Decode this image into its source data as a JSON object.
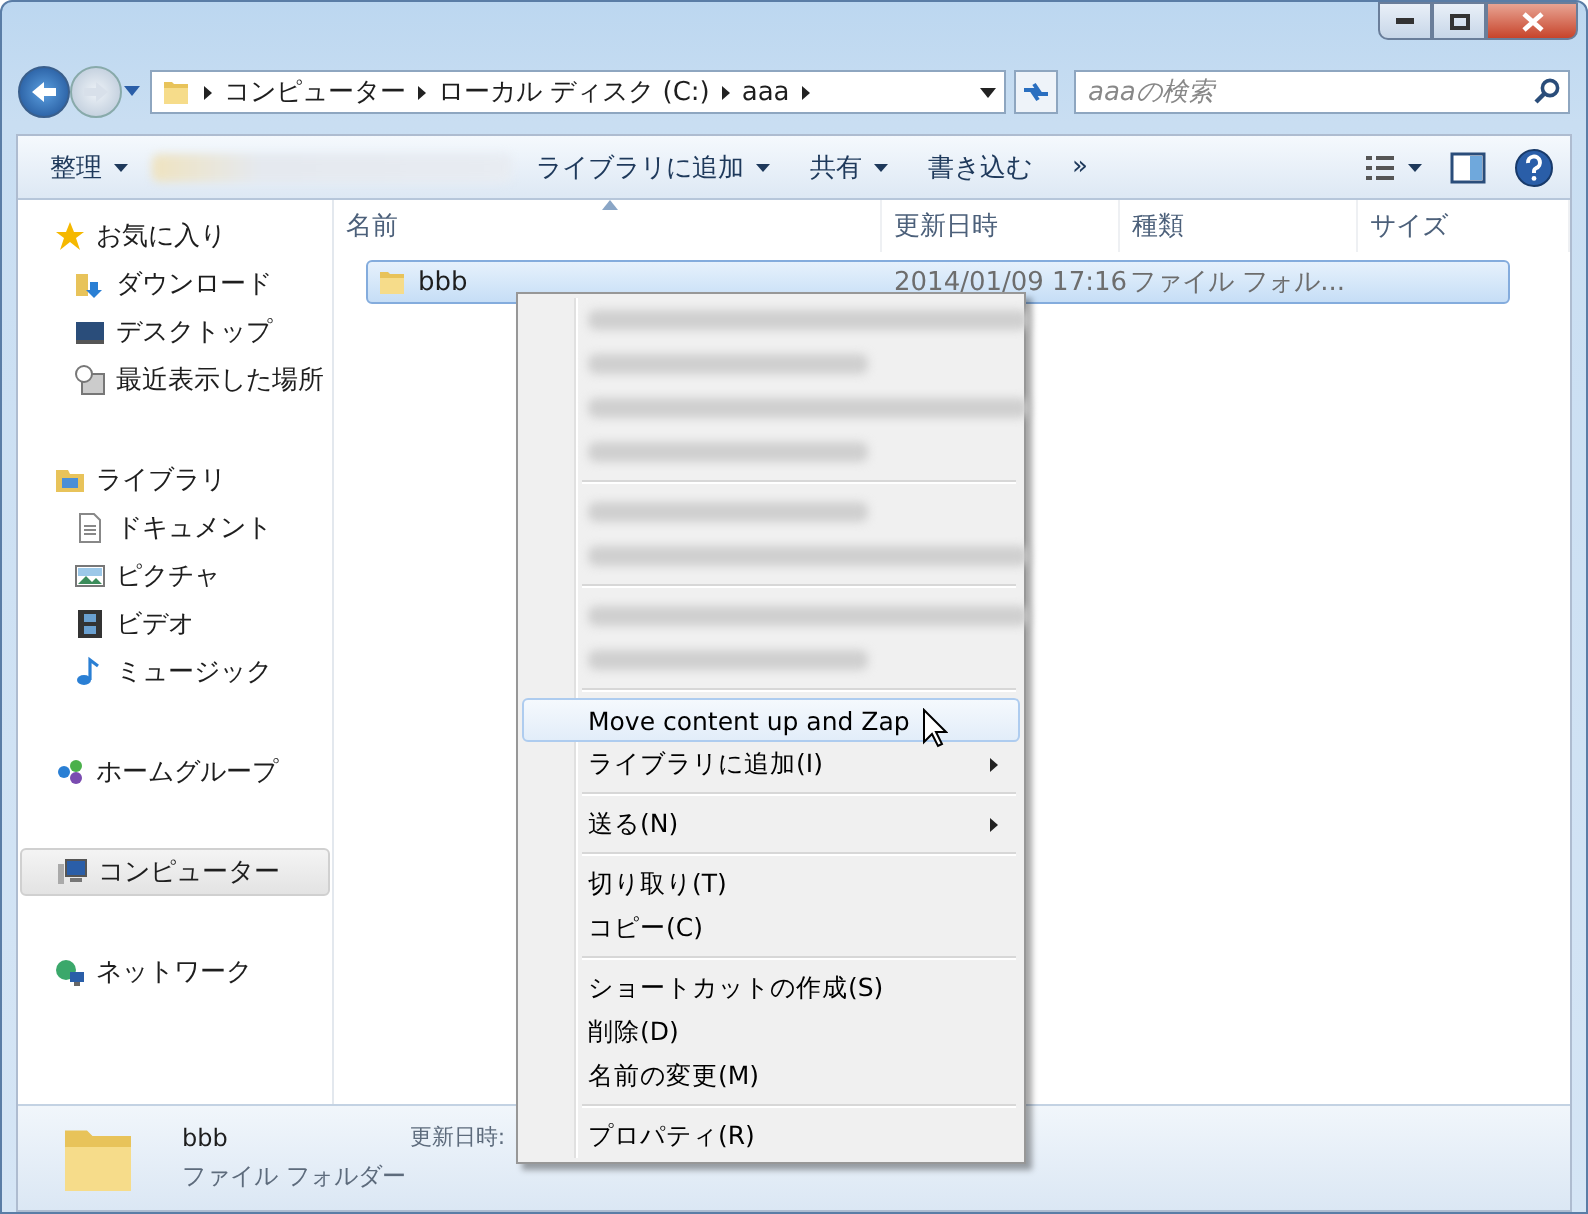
{
  "address": {
    "segments": [
      "コンピューター",
      "ローカル ディスク (C:)",
      "aaa"
    ]
  },
  "search": {
    "placeholder": "aaaの検索"
  },
  "toolbar": {
    "items": [
      {
        "kind": "dropdown",
        "label": "整理"
      },
      {
        "kind": "blurred"
      },
      {
        "kind": "dropdown",
        "label": "ライブラリに追加"
      },
      {
        "kind": "dropdown",
        "label": "共有"
      },
      {
        "kind": "plain",
        "label": "書き込む"
      },
      {
        "kind": "plain",
        "label": "»"
      }
    ]
  },
  "sidebar": {
    "items": [
      {
        "label": "お気に入り",
        "selected": false,
        "children": [
          {
            "label": "ダウンロード",
            "selected": false
          },
          {
            "label": "デスクトップ",
            "selected": false
          },
          {
            "label": "最近表示した場所",
            "selected": false
          }
        ]
      },
      {
        "label": "ライブラリ",
        "selected": false,
        "children": [
          {
            "label": "ドキュメント",
            "selected": false
          },
          {
            "label": "ピクチャ",
            "selected": false
          },
          {
            "label": "ビデオ",
            "selected": false
          },
          {
            "label": "ミュージック",
            "selected": false
          }
        ]
      },
      {
        "label": "ホームグループ",
        "selected": false
      },
      {
        "label": "コンピューター",
        "selected": true
      },
      {
        "label": "ネットワーク",
        "selected": false
      }
    ]
  },
  "table": {
    "columns": [
      "名前",
      "更新日時",
      "種類",
      "サイズ"
    ],
    "rows": [
      {
        "name": "bbb",
        "modified": "2014/01/09 17:16",
        "type": "ファイル フォル...",
        "selected": true
      }
    ]
  },
  "context_menu": {
    "items": [
      {
        "kind": "blurred"
      },
      {
        "kind": "blurred"
      },
      {
        "kind": "blurred"
      },
      {
        "kind": "blurred"
      },
      {
        "kind": "separator"
      },
      {
        "kind": "blurred"
      },
      {
        "kind": "blurred"
      },
      {
        "kind": "separator"
      },
      {
        "kind": "blurred"
      },
      {
        "kind": "blurred"
      },
      {
        "kind": "separator"
      },
      {
        "kind": "item",
        "label": "Move content up and Zap",
        "submenu": false,
        "selected": true
      },
      {
        "kind": "item",
        "label": "ライブラリに追加(I)",
        "submenu": true,
        "selected": false
      },
      {
        "kind": "separator"
      },
      {
        "kind": "item",
        "label": "送る(N)",
        "submenu": true,
        "selected": false
      },
      {
        "kind": "separator"
      },
      {
        "kind": "item",
        "label": "切り取り(T)",
        "submenu": false,
        "selected": false
      },
      {
        "kind": "item",
        "label": "コピー(C)",
        "submenu": false,
        "selected": false
      },
      {
        "kind": "separator"
      },
      {
        "kind": "item",
        "label": "ショートカットの作成(S)",
        "submenu": false,
        "selected": false
      },
      {
        "kind": "item",
        "label": "削除(D)",
        "submenu": false,
        "selected": false
      },
      {
        "kind": "item",
        "label": "名前の変更(M)",
        "submenu": false,
        "selected": false
      },
      {
        "kind": "separator"
      },
      {
        "kind": "item",
        "label": "プロパティ(R)",
        "submenu": false,
        "selected": false
      }
    ]
  },
  "details": {
    "name": "bbb",
    "type": "ファイル フォルダー",
    "modified_label": "更新日時:"
  }
}
